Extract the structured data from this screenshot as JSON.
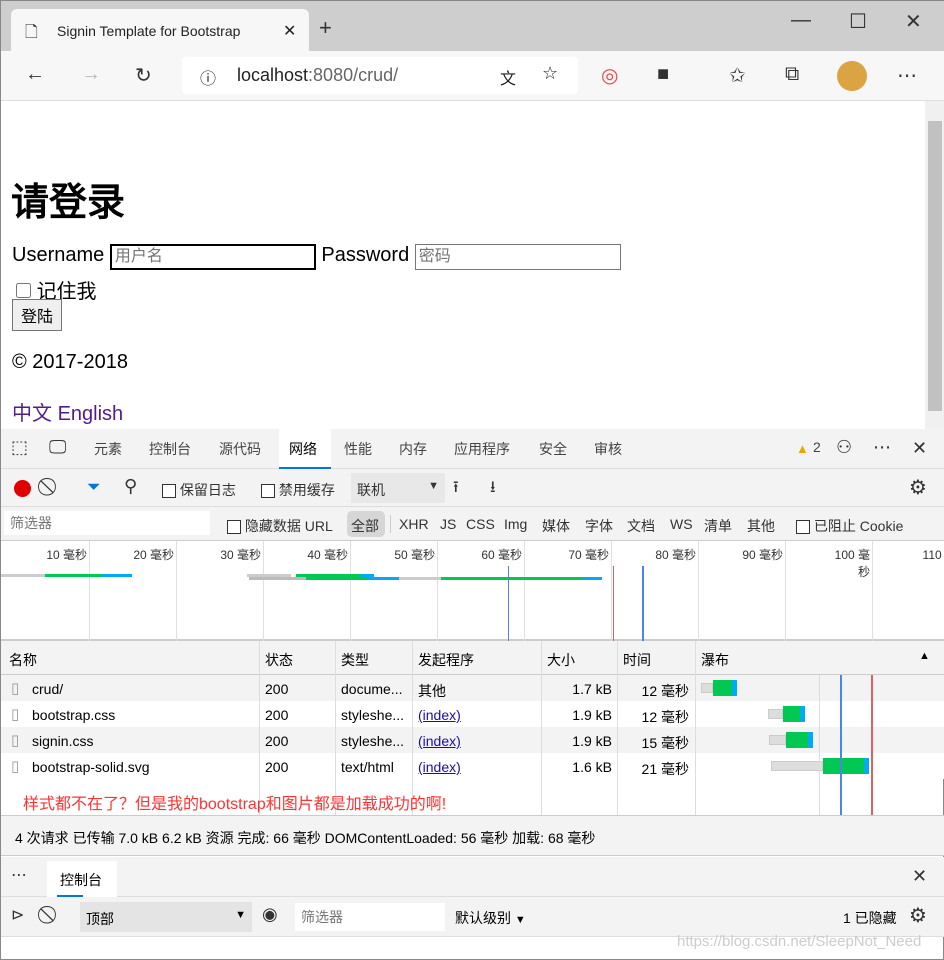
{
  "browser": {
    "tab_title": "Signin Template for Bootstrap",
    "url_host": "localhost",
    "url_rest": ":8080/crud/",
    "window_buttons": [
      "minimize",
      "maximize",
      "close"
    ]
  },
  "page": {
    "heading": "请登录",
    "username_label": "Username",
    "username_placeholder": "用户名",
    "password_label": "Password",
    "password_placeholder": "密码",
    "remember_label": "记住我",
    "login_button": "登陆",
    "copyright": "© 2017-2018",
    "lang_zh": "中文",
    "lang_en": "English"
  },
  "devtools": {
    "tabs": [
      "元素",
      "控制台",
      "源代码",
      "网络",
      "性能",
      "内存",
      "应用程序",
      "安全",
      "审核"
    ],
    "active_tab": "网络",
    "warning_count": "2",
    "toolbar": {
      "preserve_log": "保留日志",
      "disable_cache": "禁用缓存",
      "throttle": "联机"
    },
    "filter": {
      "placeholder": "筛选器",
      "hide_data_url": "隐藏数据 URL",
      "types": [
        "全部",
        "XHR",
        "JS",
        "CSS",
        "Img",
        "媒体",
        "字体",
        "文档",
        "WS",
        "清单",
        "其他"
      ],
      "blocked_cookies": "已阻止 Cookie"
    },
    "timeline_ticks": [
      "10 毫秒",
      "20 毫秒",
      "30 毫秒",
      "40 毫秒",
      "50 毫秒",
      "60 毫秒",
      "70 毫秒",
      "80 毫秒",
      "90 毫秒",
      "100 毫秒",
      "110 毫秒"
    ],
    "columns": [
      "名称",
      "状态",
      "类型",
      "发起程序",
      "大小",
      "时间",
      "瀑布"
    ],
    "rows": [
      {
        "name": "crud/",
        "status": "200",
        "type": "docume...",
        "initiator": "其他",
        "size": "1.7 kB",
        "time": "12 毫秒",
        "icon": "document-icon"
      },
      {
        "name": "bootstrap.css",
        "status": "200",
        "type": "styleshe...",
        "initiator": "(index)",
        "size": "1.9 kB",
        "time": "12 毫秒",
        "icon": "document-icon"
      },
      {
        "name": "signin.css",
        "status": "200",
        "type": "styleshe...",
        "initiator": "(index)",
        "size": "1.9 kB",
        "time": "15 毫秒",
        "icon": "document-icon"
      },
      {
        "name": "bootstrap-solid.svg",
        "status": "200",
        "type": "text/html",
        "initiator": "(index)",
        "size": "1.6 kB",
        "time": "21 毫秒",
        "icon": "image-icon"
      }
    ],
    "annotation": "样式都不在了？但是我的bootstrap和图片都是加载成功的啊!",
    "summary": "4 次请求  已传输 7.0 kB  6.2 kB 资源  完成: 66 毫秒  DOMContentLoaded: 56 毫秒  加载: 68 毫秒",
    "drawer_tab": "控制台",
    "console": {
      "context": "顶部",
      "filter_placeholder": "筛选器",
      "level": "默认级别",
      "hidden": "1 已隐藏"
    }
  },
  "watermark": "https://blog.csdn.net/SleepNot_Need",
  "colors": {
    "record": "#e00000",
    "accent": "#0078d7",
    "waiting": "#00c853",
    "download": "#03a9f4",
    "dcl_line": "#4a86e8",
    "load_line": "#e06060",
    "annotation": "#ff3333"
  }
}
